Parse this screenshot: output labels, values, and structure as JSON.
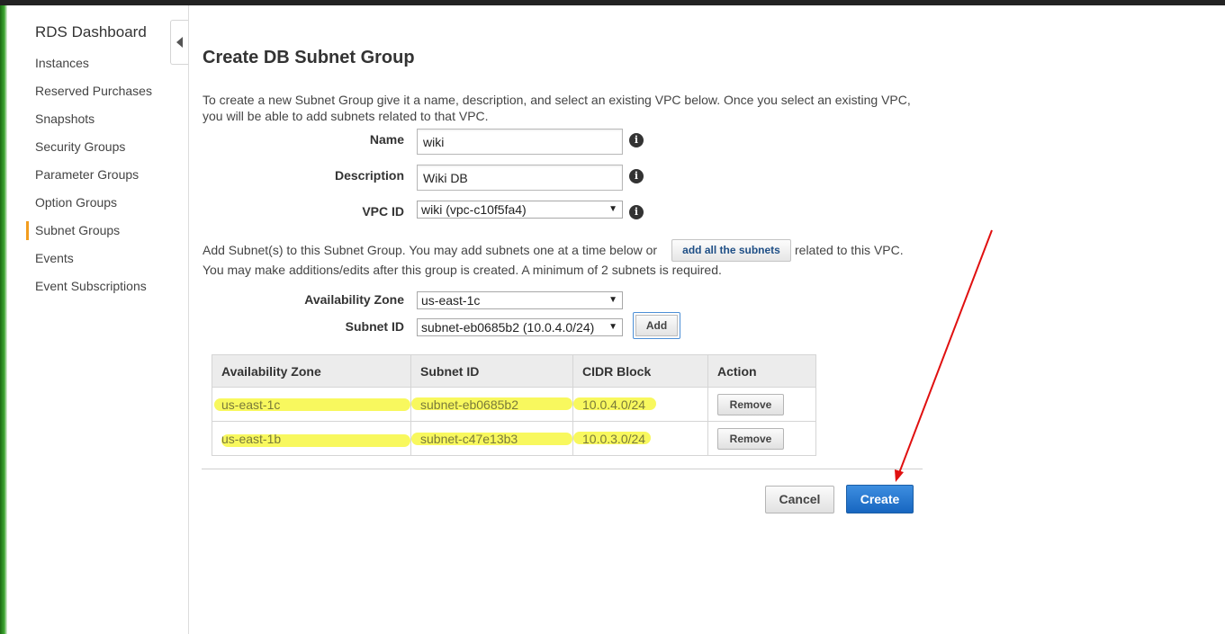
{
  "sidebar": {
    "title": "RDS Dashboard",
    "items": [
      {
        "label": "Instances"
      },
      {
        "label": "Reserved Purchases"
      },
      {
        "label": "Snapshots"
      },
      {
        "label": "Security Groups"
      },
      {
        "label": "Parameter Groups"
      },
      {
        "label": "Option Groups"
      },
      {
        "label": "Subnet Groups"
      },
      {
        "label": "Events"
      },
      {
        "label": "Event Subscriptions"
      }
    ],
    "active_item": "Subnet Groups"
  },
  "form": {
    "title": "Create DB Subnet Group",
    "intro": "To create a new Subnet Group give it a name, description, and select an existing VPC below. Once you select an existing VPC, you will be able to add subnets related to that VPC.",
    "name_label": "Name",
    "name_value": "wiki",
    "description_label": "Description",
    "description_value": "Wiki DB",
    "vpc_label": "VPC ID",
    "vpc_value": "wiki (vpc-c10f5fa4)",
    "add_subnets_prefix": "Add Subnet(s) to this Subnet Group. You may add subnets one at a time below or",
    "add_all_label": "add all the subnets",
    "add_subnets_suffix": "related to this VPC.",
    "add_subnets_note": "You may make additions/edits after this group is created. A minimum of 2 subnets is required.",
    "az_label": "Availability Zone",
    "az_value": "us-east-1c",
    "subnet_label": "Subnet ID",
    "subnet_value": "subnet-eb0685b2 (10.0.4.0/24)",
    "add_label": "Add"
  },
  "table": {
    "headers": [
      "Availability Zone",
      "Subnet ID",
      "CIDR Block",
      "Action"
    ],
    "rows": [
      {
        "az": "us-east-1c",
        "subnet": "subnet-eb0685b2",
        "cidr": "10.0.4.0/24",
        "action": "Remove"
      },
      {
        "az": "us-east-1b",
        "subnet": "subnet-c47e13b3",
        "cidr": "10.0.3.0/24",
        "action": "Remove"
      }
    ],
    "highlight_color": "#f5f528"
  },
  "footer": {
    "cancel_label": "Cancel",
    "create_label": "Create"
  },
  "colors": {
    "accent_active": "#f29d1f",
    "primary_button": "#1f72cc",
    "annotation_arrow": "#e01010"
  }
}
